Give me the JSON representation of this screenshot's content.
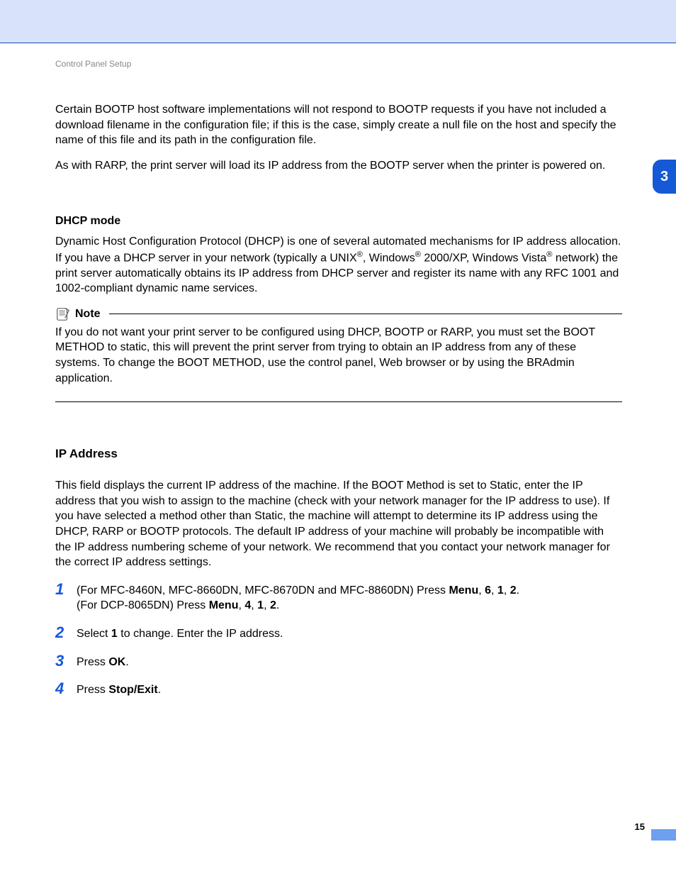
{
  "page": {
    "running_head": "Control Panel Setup",
    "chapter_tab": "3",
    "page_number": "15"
  },
  "intro": {
    "p1": "Certain BOOTP host software implementations will not respond to BOOTP requests if you have not included a download filename in the configuration file; if this is the case, simply create a null file on the host and specify the name of this file and its path in the configuration file.",
    "p2": "As with RARP, the print server will load its IP address from the BOOTP server when the printer is powered on."
  },
  "dhcp": {
    "heading": "DHCP mode",
    "body_pre": "Dynamic Host Configuration Protocol (DHCP) is one of several automated mechanisms for IP address allocation. If you have a DHCP server in your network (typically a UNIX",
    "reg1": "®",
    "body_mid1": ", Windows",
    "reg2": "®",
    "body_mid2": " 2000/XP, Windows Vista",
    "reg3": "®",
    "body_post": " network) the print server automatically obtains its IP address from DHCP server and register its name with any RFC 1001 and 1002-compliant dynamic name services."
  },
  "note": {
    "label": "Note",
    "body": "If you do not want your print server to be configured using DHCP, BOOTP or RARP, you must set the BOOT METHOD to static, this will prevent the print server from trying to obtain an IP address from any of these systems. To change the BOOT METHOD, use the control panel, Web browser or by using the BRAdmin application."
  },
  "ip": {
    "heading": "IP Address",
    "body": "This field displays the current IP address of the machine. If the BOOT Method is set to Static, enter the IP address that you wish to assign to the machine (check with your network manager for the IP address to use). If you have selected a method other than Static, the machine will attempt to determine its IP address using the DHCP, RARP or BOOTP protocols. The default IP address of your machine will probably be incompatible with the IP address numbering scheme of your network. We recommend that you contact your network manager for the correct IP address settings."
  },
  "steps": {
    "n1": "1",
    "s1_a_pre": "(For MFC-8460N, MFC-8660DN, MFC-8670DN and MFC-8860DN) Press ",
    "s1_a_menu": "Menu",
    "s1_a_c1": ", ",
    "s1_a_k1": "6",
    "s1_a_c2": ", ",
    "s1_a_k2": "1",
    "s1_a_c3": ", ",
    "s1_a_k3": "2",
    "s1_a_end": ".",
    "s1_b_pre": "(For DCP-8065DN) Press ",
    "s1_b_menu": "Menu",
    "s1_b_c1": ", ",
    "s1_b_k1": "4",
    "s1_b_c2": ", ",
    "s1_b_k2": "1",
    "s1_b_c3": ", ",
    "s1_b_k3": "2",
    "s1_b_end": ".",
    "n2": "2",
    "s2_pre": "Select ",
    "s2_key": "1",
    "s2_post": " to change. Enter the IP address.",
    "n3": "3",
    "s3_pre": "Press ",
    "s3_key": "OK",
    "s3_post": ".",
    "n4": "4",
    "s4_pre": "Press ",
    "s4_key": "Stop/Exit",
    "s4_post": "."
  }
}
